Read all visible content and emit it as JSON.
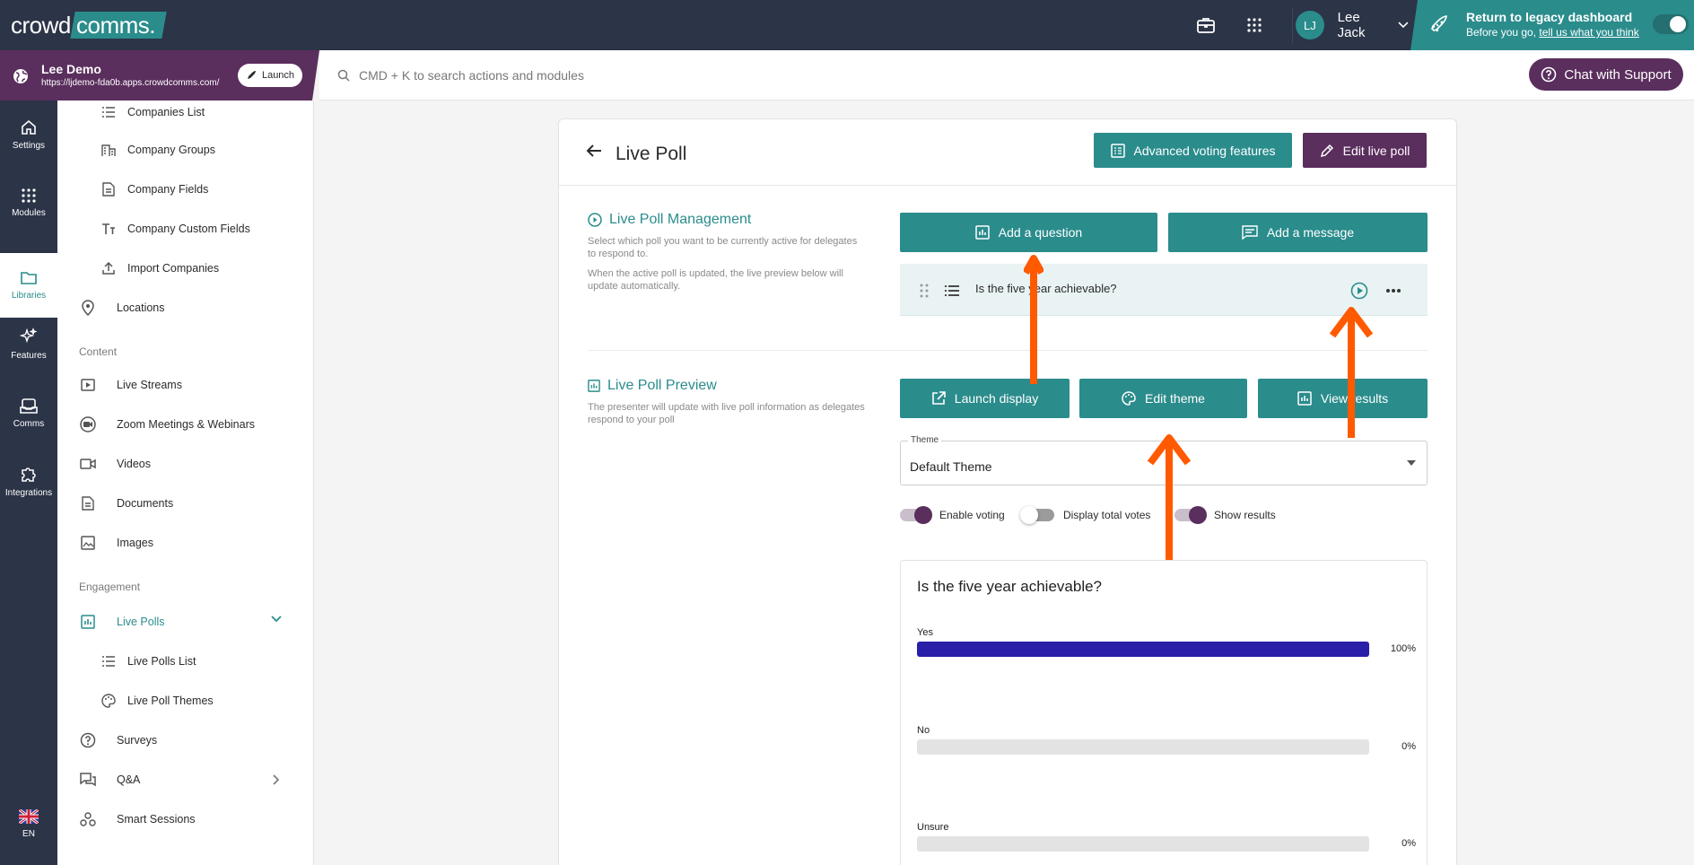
{
  "topbar": {
    "logo_text_1": "crowd",
    "logo_text_2": "comms.",
    "user_initials": "LJ",
    "user_name": "Lee Jack",
    "legacy_title": "Return to legacy dashboard",
    "legacy_sub_prefix": "Before you go, ",
    "legacy_sub_link": "tell us what you think"
  },
  "event": {
    "name": "Lee Demo",
    "url": "https://ljdemo-fda0b.apps.crowdcomms.com/",
    "launch_label": "Launch"
  },
  "search": {
    "placeholder": "CMD + K to search actions and modules"
  },
  "support": {
    "label": "Chat with Support"
  },
  "rail": {
    "items": [
      {
        "label": "Settings",
        "icon": "home-icon"
      },
      {
        "label": "Modules",
        "icon": "grid-icon"
      },
      {
        "label": "Libraries",
        "icon": "folder-icon"
      },
      {
        "label": "Features",
        "icon": "sparkle-icon"
      },
      {
        "label": "Comms",
        "icon": "inbox-icon"
      },
      {
        "label": "Integrations",
        "icon": "puzzle-icon"
      }
    ],
    "lang": "EN"
  },
  "subnav": {
    "items": [
      {
        "label": "Companies List"
      },
      {
        "label": "Company Groups"
      },
      {
        "label": "Company Fields"
      },
      {
        "label": "Company Custom Fields"
      },
      {
        "label": "Import Companies"
      },
      {
        "label": "Locations"
      },
      {
        "label": "Live Streams"
      },
      {
        "label": "Zoom Meetings & Webinars"
      },
      {
        "label": "Videos"
      },
      {
        "label": "Documents"
      },
      {
        "label": "Images"
      },
      {
        "label": "Live Polls"
      },
      {
        "label": "Live Polls List"
      },
      {
        "label": "Live Poll Themes"
      },
      {
        "label": "Surveys"
      },
      {
        "label": "Q&A"
      },
      {
        "label": "Smart Sessions"
      }
    ],
    "headers": {
      "content": "Content",
      "engagement": "Engagement"
    }
  },
  "page": {
    "title": "Live Poll",
    "advanced_label": "Advanced voting features",
    "edit_label": "Edit live poll"
  },
  "management": {
    "title": "Live Poll Management",
    "desc1": "Select which poll you want to be currently active for delegates to respond to.",
    "desc2": "When the active poll is updated, the live preview below will update automatically.",
    "add_question": "Add a question",
    "add_message": "Add a message",
    "poll_question": "Is the five year achievable?"
  },
  "preview_section": {
    "title": "Live Poll Preview",
    "desc": "The presenter will update with live poll information as delegates respond to your poll",
    "launch_display": "Launch display",
    "edit_theme": "Edit theme",
    "view_results": "View results",
    "theme_label": "Theme",
    "theme_value": "Default Theme",
    "toggles": [
      {
        "label": "Enable voting",
        "on": true
      },
      {
        "label": "Display total votes",
        "on": false
      },
      {
        "label": "Show results",
        "on": true
      }
    ]
  },
  "poll_preview": {
    "question": "Is the five year achievable?",
    "options": [
      {
        "label": "Yes",
        "percent": 100,
        "percent_text": "100%"
      },
      {
        "label": "No",
        "percent": 0,
        "percent_text": "0%"
      },
      {
        "label": "Unsure",
        "percent": 0,
        "percent_text": "0%"
      }
    ]
  },
  "colors": {
    "navy": "#2c3447",
    "teal": "#2b8c8c",
    "purple": "#5a2e5d",
    "bar_fill": "#2a1fa8",
    "annotation_arrow": "#ff5a00"
  }
}
